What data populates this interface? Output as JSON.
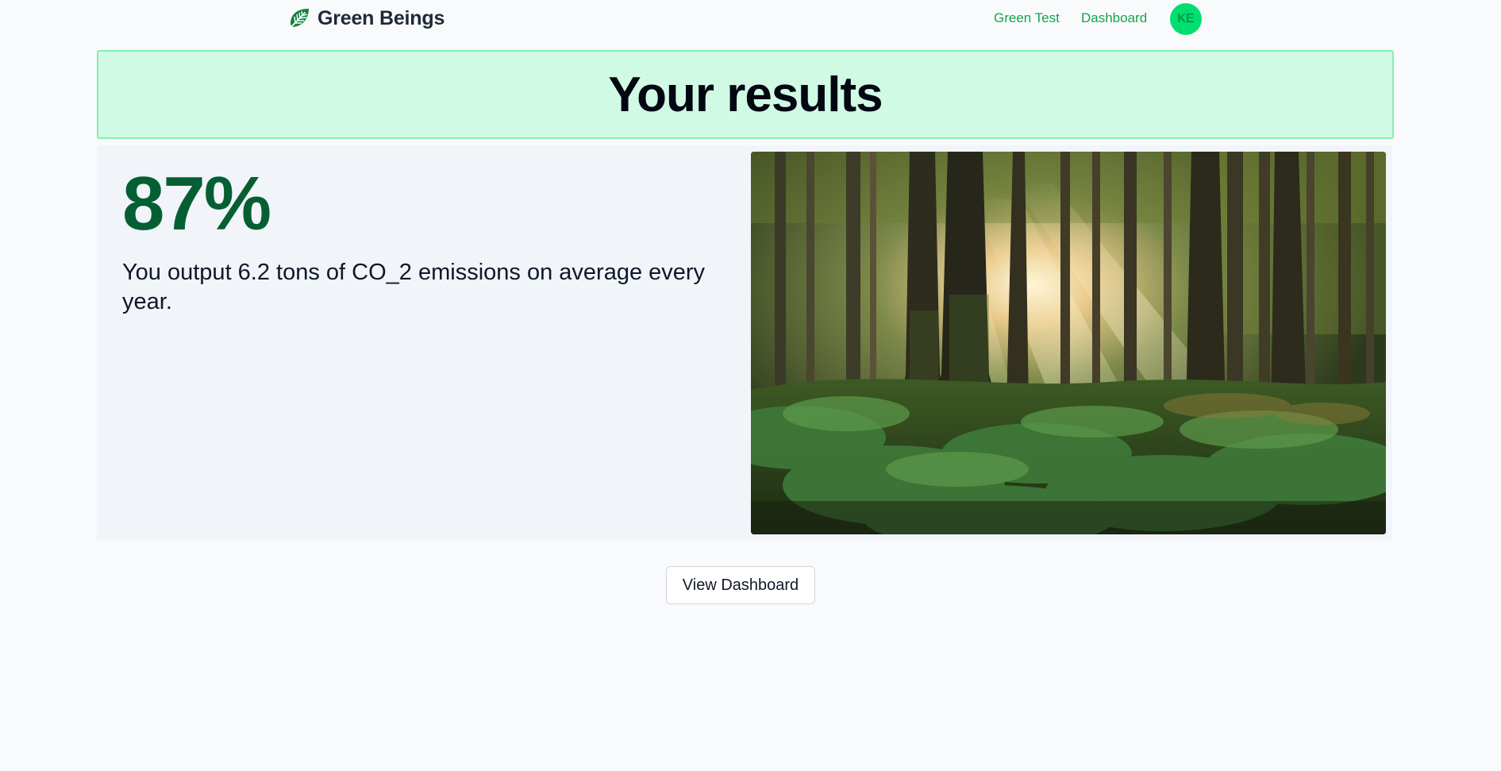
{
  "nav": {
    "brand_name": "Green Beings",
    "brand_icon": "leaf-icon",
    "links": [
      "Green Test",
      "Dashboard"
    ],
    "avatar_initials": "KE"
  },
  "banner": {
    "title": "Your results"
  },
  "result": {
    "score": "87%",
    "description": "You output 6.2 tons of CO_2 emissions on average every year."
  },
  "image": {
    "subject": "sunlit forest with ferns and tall trees"
  },
  "actions": {
    "view_dashboard_label": "View Dashboard"
  },
  "colors": {
    "accent_green": "#16a34a",
    "score_green": "#065f33",
    "banner_bg": "#d1fae5",
    "avatar_bg": "#00de6f"
  }
}
